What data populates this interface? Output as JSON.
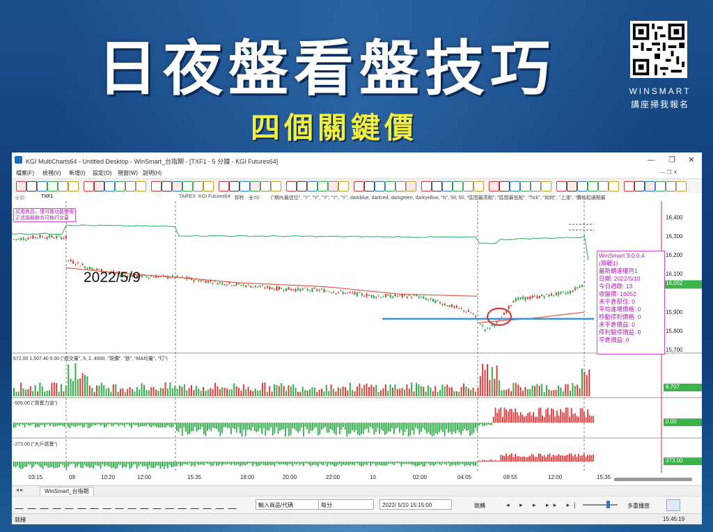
{
  "banner": {
    "headline": "日夜盤看盤技巧",
    "subline": "四個關鍵價",
    "brand": "WINSMART",
    "qr_note": "講座掃我報名"
  },
  "window": {
    "title": "KGI MultiCharts64 - Untitled Desktop - WinSmart_台指期 - [TXF1 - 5 分鐘 - KGI Futures64]",
    "controls": {
      "minimize": "—",
      "restore": "❐",
      "close": "✕"
    },
    "menu": [
      "檔案(F)",
      "檢視(V)",
      "新增(I)",
      "設定(O)",
      "視窗(W)",
      "說明(H)"
    ]
  },
  "chartbar": {
    "symbol": "TXF1",
    "items": [
      "TAIFEX",
      "KGI Futures64",
      "即秒",
      "全=0"
    ],
    "study_text": "(\"期內最佳位\", \"Y\", \"Y\", \"Y\", \"Y\", \"Y\", darkblue, darkred, darkgreen, darkyellow, \"N\", 50, 50, \"區間最高點\", \"區間最低點\", \"Tick\", \"如何\", \"上漲\", \"價格起讓期最"
  },
  "chart": {
    "date_annotation": "2022/5/9",
    "info_box": [
      "WinSmart 3.0.0.4",
      "(兩範1)",
      "最新期達權月1",
      "日期: 2022/5/10",
      "今日週跌: 13",
      "收盤價: 16052",
      "未平倉部位: 0",
      "平均進場價格: 0",
      "移動停利價格: 0",
      "未平倉損益: 0",
      "停利驗停損益: 0",
      "平倉損益: 0"
    ],
    "price_ticks": [
      "16,400",
      "16,300",
      "16,200",
      "16,100",
      "16,052",
      "15,900",
      "15,800",
      "15,700"
    ],
    "current_price": "16,052",
    "volume_label": "672.00  1,507.40  0.00  (\"成交量\", 5, 2, 4000, \"現價\", \"張\", \"MA均量\", \"灯\")",
    "volume_right": "6,707",
    "pane3_label": "-505.00  (\"買賣力道\")",
    "pane3_right": "0.00",
    "pane4_label": "-273.00  (\"大戶買賣\")",
    "pane4_right": "373.00",
    "time_labels": [
      "03:15",
      "09",
      "10:20",
      "12:00",
      "15:35",
      "18:00",
      "20:00",
      "22:00",
      "10",
      "02:00",
      "04:05",
      "09:55",
      "12:00",
      "15:35"
    ],
    "left_note": "試用商品，僅可做功能使用\n正式版解鎖方可執行交易"
  },
  "tabs": {
    "active": "WinSmart_台指期"
  },
  "drawbar": {
    "symbol_field": "輸入商品/代碼",
    "interval_field": "每分",
    "datetime_field": "2022/ 5/10 15:15:00",
    "jump_label": "跳轉",
    "multi_label": "多重播放"
  },
  "status": {
    "left": "就緒",
    "clock": "15:45:19"
  },
  "colors": {
    "up": "#e03a3a",
    "down": "#2fae4a",
    "ma_red": "#e0503a",
    "ma_green": "#33b56a",
    "support_line": "#3d8fd6",
    "circle": "#d23b3b"
  }
}
